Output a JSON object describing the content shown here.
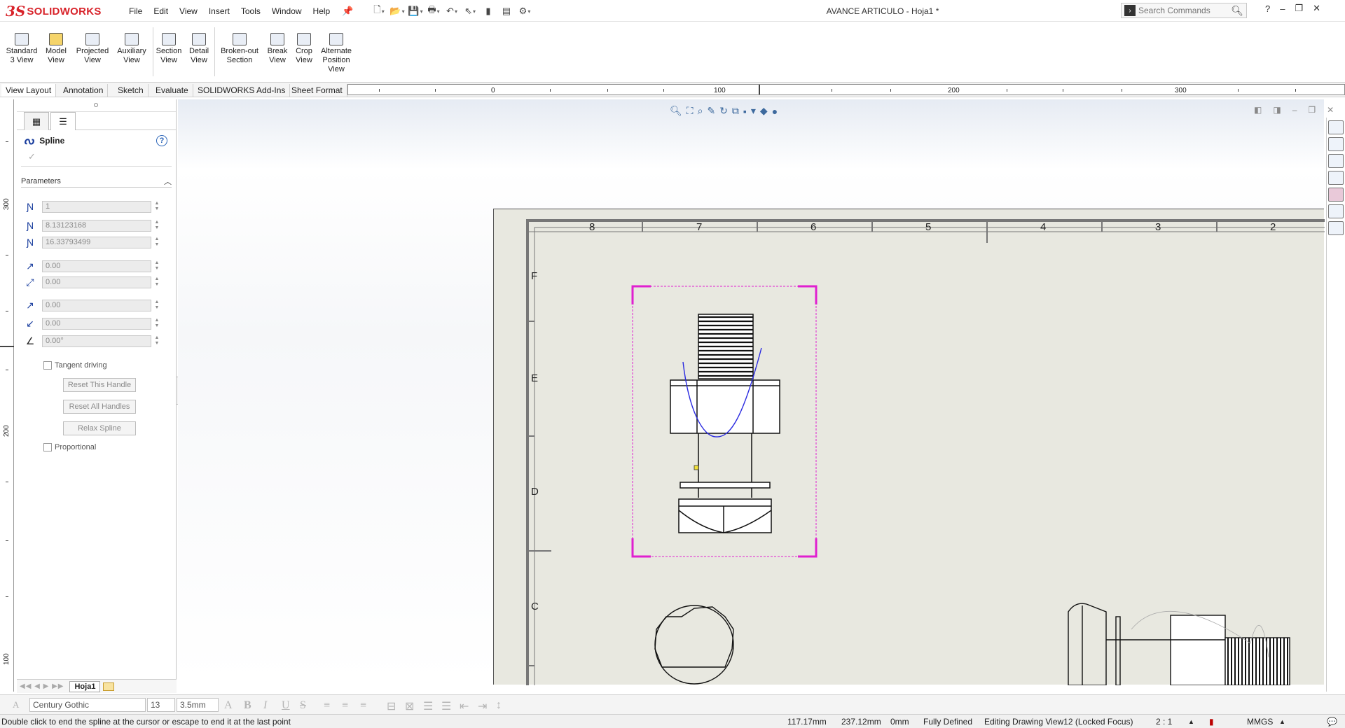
{
  "app": {
    "logo_ds": "3S",
    "logo_word": "SOLIDWORKS",
    "document_title": "AVANCE ARTICULO - Hoja1 *"
  },
  "menu": [
    "File",
    "Edit",
    "View",
    "Insert",
    "Tools",
    "Window",
    "Help"
  ],
  "search": {
    "placeholder": "Search Commands"
  },
  "command_manager": [
    {
      "label1": "Standard",
      "label2": "3 View"
    },
    {
      "label1": "Model",
      "label2": "View"
    },
    {
      "label1": "Projected",
      "label2": "View"
    },
    {
      "label1": "Auxiliary",
      "label2": "View"
    },
    {
      "label1": "Section",
      "label2": "View"
    },
    {
      "label1": "Detail",
      "label2": "View"
    },
    {
      "label1": "Broken-out",
      "label2": "Section"
    },
    {
      "label1": "Break",
      "label2": "View"
    },
    {
      "label1": "Crop",
      "label2": "View"
    },
    {
      "label1": "Alternate",
      "label2": "Position",
      "label3": "View"
    }
  ],
  "tabs": [
    "View Layout",
    "Annotation",
    "Sketch",
    "Evaluate",
    "SOLIDWORKS Add-Ins",
    "Sheet Format"
  ],
  "ruler_h": [
    "0",
    "100",
    "200",
    "300"
  ],
  "ruler_v": [
    "300",
    "200",
    "100"
  ],
  "property_manager": {
    "title": "Spline",
    "help": "?",
    "ok": "✓",
    "section": "Parameters",
    "fields": [
      "1",
      "8.13123168",
      "16.33793499",
      "0.00",
      "0.00",
      "0.00",
      "0.00",
      "0.00°"
    ],
    "tangent_driving": "Tangent driving",
    "reset_handle": "Reset This Handle",
    "reset_all": "Reset All Handles",
    "relax": "Relax Spline",
    "proportional": "Proportional"
  },
  "sheet": {
    "col_labels": [
      "8",
      "7",
      "6",
      "5",
      "4",
      "3",
      "2"
    ],
    "row_labels": [
      "F",
      "E",
      "D",
      "C"
    ]
  },
  "sheet_tabs": {
    "active": "Hoja1"
  },
  "format_bar": {
    "font": "Century Gothic",
    "size": "13",
    "height": "3.5mm"
  },
  "status": {
    "message": "Double click to end the spline at the cursor or escape to end it at the last point",
    "x": "117.17mm",
    "y": "237.12mm",
    "z": "0mm",
    "state": "Fully Defined",
    "editing": "Editing Drawing View12 (Locked Focus)",
    "scale": "2 : 1",
    "units": "MMGS"
  },
  "colors": {
    "accent": "#d8232a",
    "spline": "#2a2ae0",
    "view_boundary": "#e020d0"
  }
}
